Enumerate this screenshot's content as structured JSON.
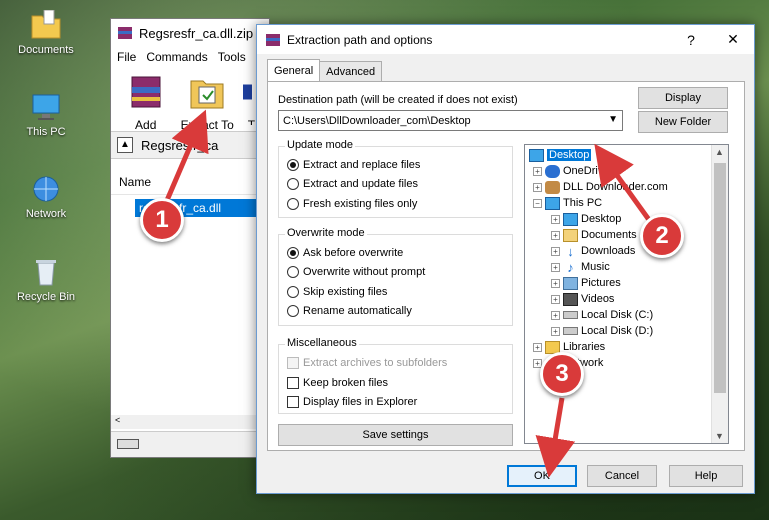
{
  "desktop": {
    "icons": [
      {
        "label": "Documents",
        "icon": "folder-icon"
      },
      {
        "label": "This PC",
        "icon": "computer-icon"
      },
      {
        "label": "Network",
        "icon": "network-icon"
      },
      {
        "label": "Recycle Bin",
        "icon": "recycle-bin-icon"
      }
    ]
  },
  "winrar": {
    "title": "Regsresfr_ca.dll.zip",
    "menu": [
      "File",
      "Commands",
      "Tools"
    ],
    "toolbar": {
      "add": "Add",
      "extract_to": "Extract To",
      "third": "T"
    },
    "path": "Regsresfr_ca",
    "column_name": "Name",
    "file": "regsresfr_ca.dll"
  },
  "dialog": {
    "title": "Extraction path and options",
    "help": "?",
    "close": "✕",
    "tabs": [
      "General",
      "Advanced"
    ],
    "dest_label": "Destination path (will be created if does not exist)",
    "dest_value": "C:\\Users\\DllDownloader_com\\Desktop",
    "display_btn": "Display",
    "newfolder_btn": "New Folder",
    "update_mode": {
      "title": "Update mode",
      "options": [
        "Extract and replace files",
        "Extract and update files",
        "Fresh existing files only"
      ],
      "selected": 0
    },
    "overwrite_mode": {
      "title": "Overwrite mode",
      "options": [
        "Ask before overwrite",
        "Overwrite without prompt",
        "Skip existing files",
        "Rename automatically"
      ],
      "selected": 0
    },
    "misc": {
      "title": "Miscellaneous",
      "options": [
        "Extract archives to subfolders",
        "Keep broken files",
        "Display files in Explorer"
      ]
    },
    "save_settings": "Save settings",
    "tree": [
      "Desktop",
      "OneDrive",
      "DLL Downloader.com",
      "This PC",
      "Desktop",
      "Documents",
      "Downloads",
      "Music",
      "Pictures",
      "Videos",
      "Local Disk (C:)",
      "Local Disk (D:)",
      "Libraries",
      "Network"
    ],
    "ok": "OK",
    "cancel": "Cancel",
    "help_btn": "Help"
  },
  "callouts": [
    "1",
    "2",
    "3"
  ],
  "colors": {
    "accent": "#0078d7",
    "callout": "#d93a3a"
  }
}
